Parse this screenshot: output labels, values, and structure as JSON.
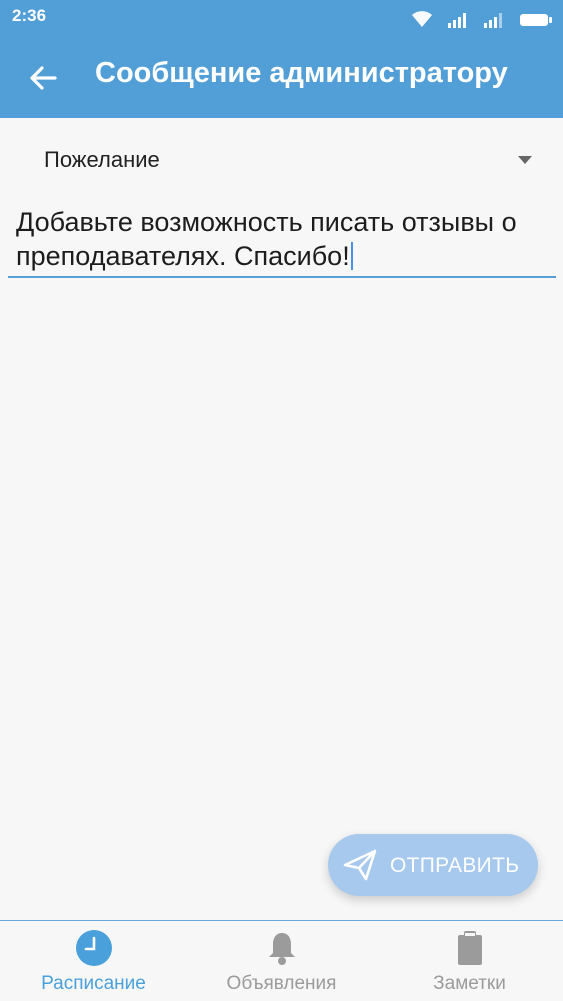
{
  "status_bar": {
    "time": "2:36"
  },
  "app_bar": {
    "title": "Сообщение администратору",
    "back_icon": "arrow-left-icon"
  },
  "message_type": {
    "selected": "Пожелание"
  },
  "message": {
    "value": "Добавьте возможность писать отзывы о преподавателях. Спасибо!"
  },
  "send_button": {
    "label": "ОТПРАВИТЬ",
    "icon": "send-icon"
  },
  "bottom_nav": {
    "items": [
      {
        "label": "Расписание",
        "icon": "clock-icon",
        "active": true
      },
      {
        "label": "Объявления",
        "icon": "bell-icon",
        "active": false
      },
      {
        "label": "Заметки",
        "icon": "clipboard-icon",
        "active": false
      }
    ]
  },
  "colors": {
    "primary": "#529ed6",
    "accent": "#4aa0da",
    "send_button_bg": "#a6c9ed",
    "inactive": "#9b9b9b"
  }
}
